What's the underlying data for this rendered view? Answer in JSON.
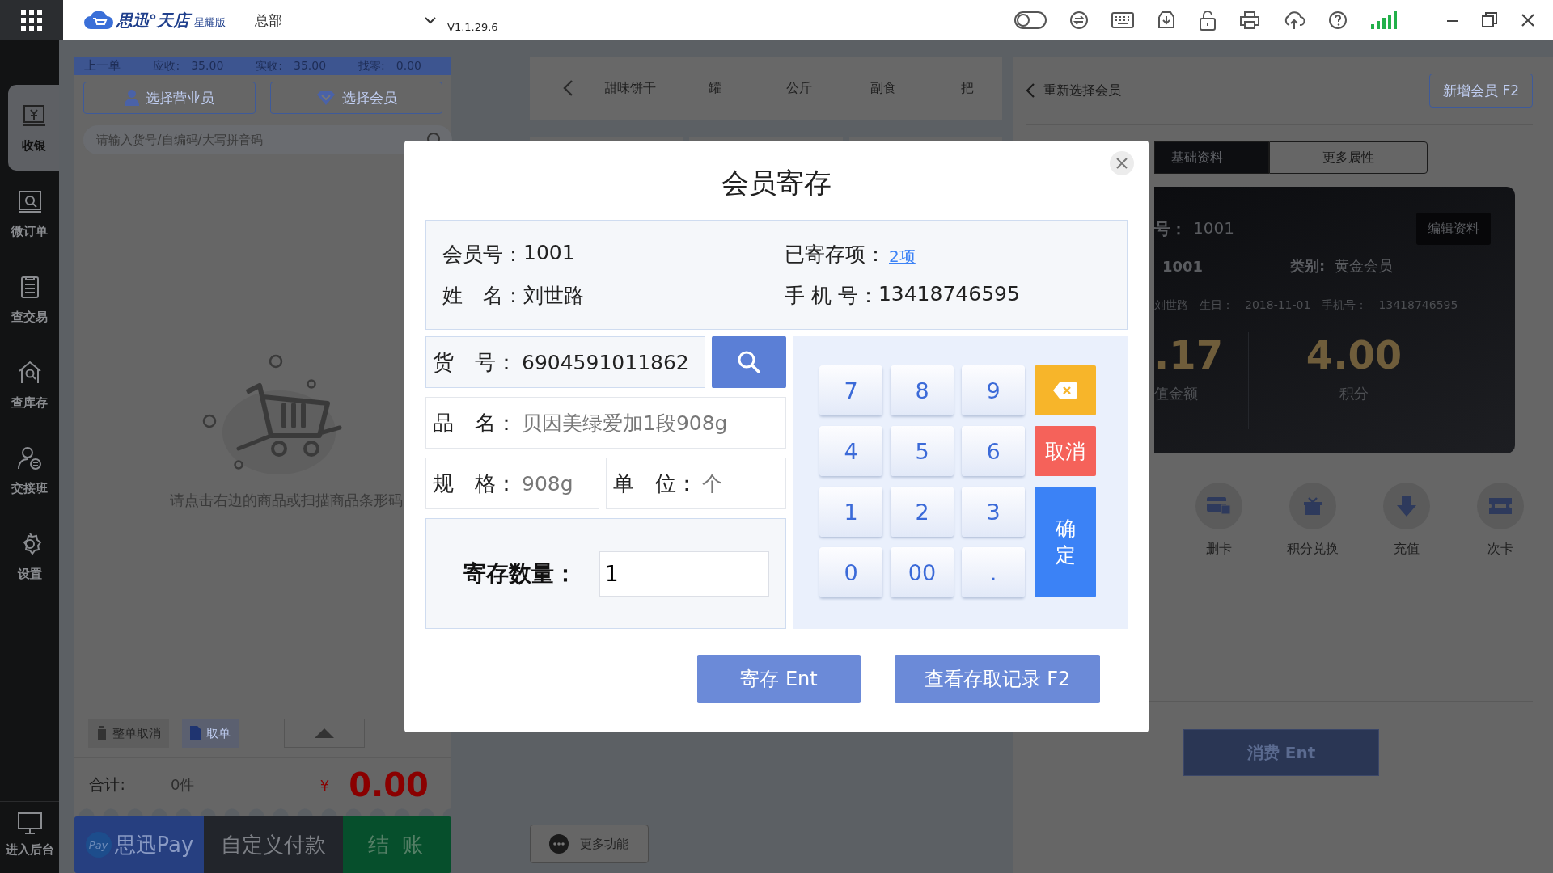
{
  "top_bar": {
    "logo": "思迅°天店",
    "edition": "星耀版",
    "store": "总部",
    "version": "V1.1.29.6"
  },
  "sidebar": {
    "items": [
      {
        "label": "收银",
        "selected": true
      },
      {
        "label": "微订单",
        "selected": false
      },
      {
        "label": "查交易",
        "selected": false
      },
      {
        "label": "查库存",
        "selected": false
      },
      {
        "label": "交接班",
        "selected": false
      },
      {
        "label": "设置",
        "selected": false
      }
    ],
    "footer": "进入后台"
  },
  "order_panel": {
    "summary": {
      "title": "上一单",
      "fields": [
        {
          "label": "应收:",
          "value": "35.00"
        },
        {
          "label": "实收:",
          "value": "35.00"
        },
        {
          "label": "找零:",
          "value": "0.00"
        }
      ]
    },
    "buttons": [
      "选择营业员",
      "选择会员"
    ],
    "search": {
      "placeholder": "请输入货号/自编码/大写拼音码"
    },
    "empty_text": "请点击右边的商品或扫描商品条形码",
    "actions": [
      "整单取消",
      "取单"
    ],
    "total": {
      "label": "合计:",
      "count": "0件",
      "currency": "¥",
      "amount": "0.00"
    },
    "payments": [
      {
        "kind": "pay",
        "badge": "Pay",
        "label": "思迅Pay"
      },
      {
        "kind": "custom",
        "label": "自定义付款"
      },
      {
        "kind": "checkout",
        "label": "结 账"
      }
    ]
  },
  "categories": [
    "甜味饼干",
    "罐",
    "公斤",
    "副食",
    "把"
  ],
  "more_button": "更多功能",
  "member_panel": {
    "back_label": "重新选择会员",
    "add_button": "新增会员 F2",
    "tabs": [
      {
        "label": "基础资料",
        "selected": true
      },
      {
        "label": "更多属性",
        "selected": false
      }
    ],
    "card": {
      "edit_button": "编辑资料",
      "number_label": "号：",
      "number": "1001",
      "card_no": "1001",
      "category_label": "类别:",
      "category": "黄金会员",
      "name": "刘世路",
      "birthday_label": "生日：",
      "birthday": "2018-11-01",
      "phone_label": "手机号：",
      "phone": "13418746595",
      "balance": ".17",
      "balance_label": "值金额",
      "points": "4.00",
      "points_label": "积分"
    },
    "actions": [
      {
        "kind": "delete",
        "label": "删卡"
      },
      {
        "kind": "gift",
        "label": "积分兑换"
      },
      {
        "kind": "recharge",
        "label": "充值"
      },
      {
        "kind": "ticket",
        "label": "次卡"
      }
    ],
    "consume_button": "消费 Ent"
  },
  "dialog": {
    "title": "会员寄存",
    "info": [
      {
        "kind": "text",
        "label": "会员号：",
        "value": "1001"
      },
      {
        "kind": "link",
        "label": "已寄存项：",
        "value": "2项"
      },
      {
        "kind": "text",
        "label": "姓　名：",
        "value": "刘世路"
      },
      {
        "kind": "text",
        "label": "手 机 号：",
        "value": "13418746595"
      }
    ],
    "code": {
      "label": "货　号：",
      "value": "6904591011862"
    },
    "product": {
      "label": "品　名：",
      "value": "贝因美绿爱加1段908g"
    },
    "spec": {
      "label": "规　格：",
      "value": "908g"
    },
    "unit": {
      "label": "单　位：",
      "value": "个"
    },
    "quantity": {
      "label": "寄存数量：",
      "value": "1"
    },
    "keys": [
      "7",
      "8",
      "9",
      "4",
      "5",
      "6",
      "1",
      "2",
      "3",
      "0",
      "00",
      "."
    ],
    "key_actions": [
      {
        "kind": "backspace"
      },
      {
        "kind": "cancel",
        "label": "取消"
      },
      {
        "kind": "confirm",
        "label": "确定"
      }
    ],
    "buttons": [
      "寄存 Ent",
      "查看存取记录 F2"
    ]
  }
}
